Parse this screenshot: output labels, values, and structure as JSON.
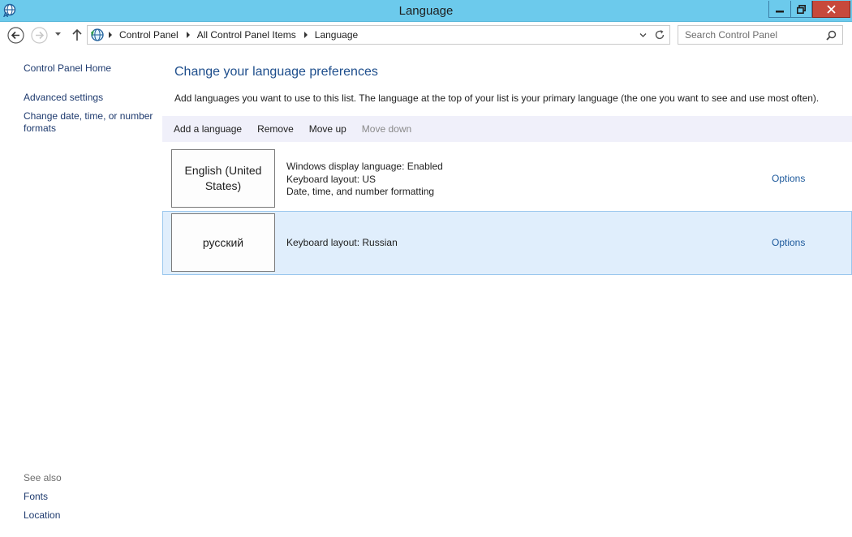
{
  "window": {
    "title": "Language",
    "app_icon": "language-globe-icon",
    "controls": [
      "minimize-icon",
      "restore-icon",
      "close-icon"
    ]
  },
  "address": {
    "breadcrumbs": [
      "Control Panel",
      "All Control Panel Items",
      "Language"
    ],
    "search_placeholder": "Search Control Panel"
  },
  "sidebar": {
    "home": "Control Panel Home",
    "advanced": "Advanced settings",
    "datetime": "Change date, time, or number formats",
    "see_also": "See also",
    "fonts": "Fonts",
    "location": "Location"
  },
  "main": {
    "title": "Change your language preferences",
    "description": "Add languages you want to use to this list. The language at the top of your list is your primary language (the one you want to see and use most often).",
    "toolbar": {
      "add": "Add a language",
      "remove": "Remove",
      "move_up": "Move up",
      "move_down": "Move down"
    },
    "languages": [
      {
        "name": "English (United States)",
        "details": [
          "Windows display language: Enabled",
          "Keyboard layout: US",
          "Date, time, and number formatting"
        ],
        "options": "Options",
        "selected": false
      },
      {
        "name": "русский",
        "details": [
          "Keyboard layout: Russian"
        ],
        "options": "Options",
        "selected": true
      }
    ]
  },
  "colors": {
    "titlebar": "#6ccaec",
    "close": "#c7493b",
    "link": "#1e5a9c",
    "selected_row": "#e0eefc"
  }
}
